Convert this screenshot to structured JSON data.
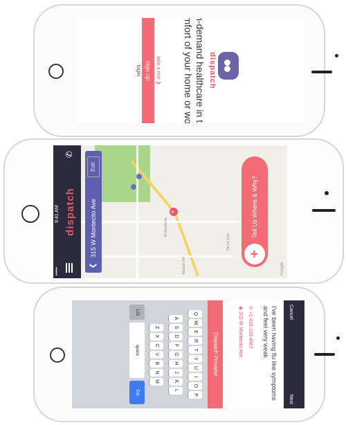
{
  "signup_screen": {
    "logo_text": "dispatch",
    "tagline": "On-demand healthcare in the comfort of your home or work.",
    "tour_link": "take a tour  ❯",
    "signup_button": "sign up",
    "login_link": "login"
  },
  "map_screen": {
    "status_time": "9:41 AM",
    "status_carrier": "••••• ",
    "title": "dispatch",
    "address": "315 W Montecito Ave",
    "edit_label": "Edit",
    "cta_label": "Tell Us Where & Why?",
    "cta_icon": "+",
    "map_labels": [
      "Mission Rd",
      "W Montecito",
      "De La Vina"
    ],
    "legal": "Google"
  },
  "request_screen": {
    "nav_left": "Cancel",
    "nav_right": "Next",
    "message": "I've been having flu like symptoms and feel very weak",
    "phone": "+1-415-123-4567",
    "address": "315 W Montecito Ave",
    "dispatch_button": "Dispatch Provider",
    "keyboard": {
      "row1": [
        "Q",
        "W",
        "E",
        "R",
        "T",
        "Y",
        "U",
        "I",
        "O",
        "P"
      ],
      "row2": [
        "A",
        "S",
        "D",
        "F",
        "G",
        "H",
        "J",
        "K",
        "L"
      ],
      "row3": [
        "Z",
        "X",
        "C",
        "V",
        "B",
        "N",
        "M"
      ],
      "num_key": "123",
      "space": "space",
      "go": "Go"
    }
  },
  "colors": {
    "brand": "#e85466",
    "navy": "#2c2a3d",
    "address_bar": "#5f5fb0",
    "park": "#a9d68a"
  }
}
